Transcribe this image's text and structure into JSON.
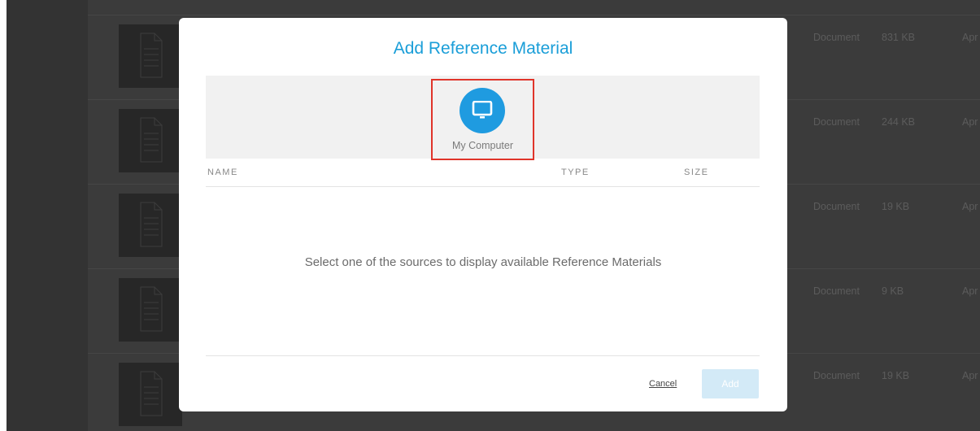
{
  "background": {
    "rows": [
      {
        "type": "Document",
        "size": "831 KB",
        "date": "Apr"
      },
      {
        "type": "Document",
        "size": "244 KB",
        "date": "Apr"
      },
      {
        "type": "Document",
        "size": "19 KB",
        "date": "Apr"
      },
      {
        "type": "Document",
        "size": "9 KB",
        "date": "Apr"
      },
      {
        "type": "Document",
        "size": "19 KB",
        "date": "Apr"
      }
    ]
  },
  "modal": {
    "title": "Add Reference Material",
    "source": {
      "label": "My Computer",
      "icon": "monitor-icon"
    },
    "columns": {
      "name": "NAME",
      "type": "TYPE",
      "size": "SIZE"
    },
    "empty_message": "Select one of the sources to display available Reference Materials",
    "cancel_label": "Cancel",
    "add_label": "Add"
  },
  "colors": {
    "accent": "#1a9ed8",
    "highlight_border": "#e0342a",
    "add_disabled": "#d3eaf7"
  }
}
